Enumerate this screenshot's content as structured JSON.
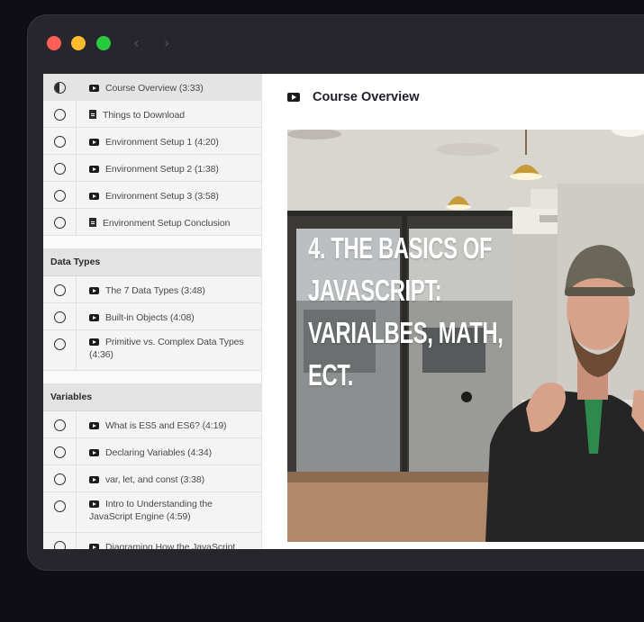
{
  "lessons_intro": [
    {
      "status": "half",
      "icon": "video",
      "label": "Course Overview (3:33)",
      "active": true
    },
    {
      "status": "empty",
      "icon": "doc",
      "label": "Things to Download"
    },
    {
      "status": "empty",
      "icon": "video",
      "label": "Environment Setup 1 (4:20)"
    },
    {
      "status": "empty",
      "icon": "video",
      "label": "Environment Setup 2 (1:38)"
    },
    {
      "status": "empty",
      "icon": "video",
      "label": "Environment Setup 3 (3:58)"
    },
    {
      "status": "empty",
      "icon": "doc",
      "label": "Environment Setup Conclusion"
    }
  ],
  "sections": [
    {
      "title": "Data Types",
      "lessons": [
        {
          "status": "empty",
          "icon": "video",
          "label": "The 7 Data Types (3:48)"
        },
        {
          "status": "empty",
          "icon": "video",
          "label": "Built-in Objects (4:08)"
        },
        {
          "status": "empty",
          "icon": "video",
          "label": "Primitive vs. Complex Data Types (4:36)"
        }
      ]
    },
    {
      "title": "Variables",
      "lessons": [
        {
          "status": "empty",
          "icon": "video",
          "label": "What is ES5 and ES6? (4:19)"
        },
        {
          "status": "empty",
          "icon": "video",
          "label": "Declaring Variables (4:34)"
        },
        {
          "status": "empty",
          "icon": "video",
          "label": "var, let, and const (3:38)"
        },
        {
          "status": "empty",
          "icon": "video",
          "label": "Intro to Understanding the JavaScript Engine (4:59)"
        },
        {
          "status": "empty",
          "icon": "video",
          "label": "Diagraming How the JavaScript"
        }
      ]
    }
  ],
  "content": {
    "lesson_title": "Course Overview",
    "video_overlay_text": "4. THE BASICS OF\nJAVASCRIPT:\nVARIALBES, MATH,\nECT."
  },
  "window": {
    "back_glyph": "‹",
    "forward_glyph": "›"
  },
  "colors": {
    "close": "#fe5f57",
    "minimize": "#febc2e",
    "maximize": "#28c840",
    "frame": "#26262c"
  }
}
